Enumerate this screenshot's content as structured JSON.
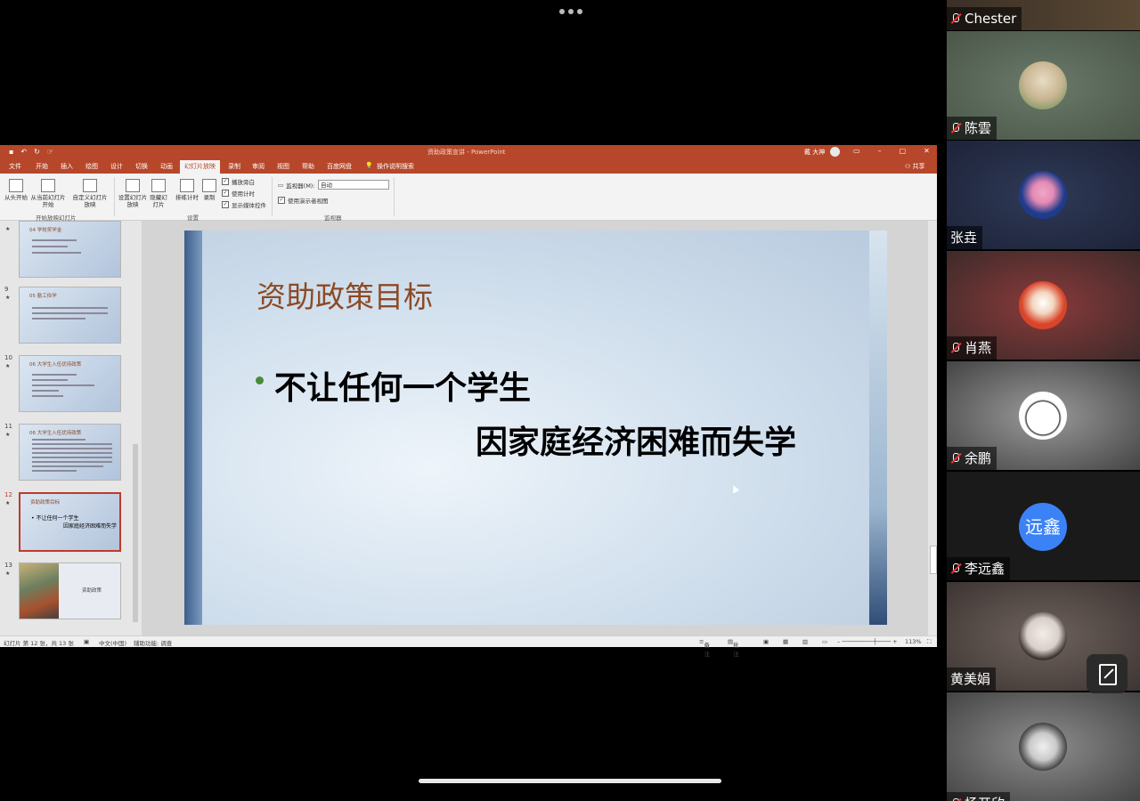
{
  "app": {
    "document_title": "资助政策宣讲 - PowerPoint",
    "user": "戴 大神",
    "share_label": "共享",
    "tabs": [
      "文件",
      "开始",
      "插入",
      "绘图",
      "设计",
      "切换",
      "动画",
      "幻灯片放映",
      "录制",
      "审阅",
      "视图",
      "帮助",
      "百度网盘",
      "操作说明搜索"
    ],
    "active_tab": "幻灯片放映"
  },
  "ribbon": {
    "from_start": "从头开始",
    "from_current": "从当前幻灯片开始",
    "custom": "自定义幻灯片放映",
    "group1": "开始放映幻灯片",
    "setup": "设置幻灯片放映",
    "hide": "隐藏幻灯片",
    "rehearse": "排练计时",
    "record": "录制",
    "chk_narration": "播放旁白",
    "chk_timing": "使用计时",
    "chk_media": "显示媒体控件",
    "group2": "设置",
    "monitor_label": "监视器(M):",
    "monitor_value": "自动",
    "chk_presenter": "使用演示者视图",
    "group3": "监视器"
  },
  "thumbs": [
    {
      "num": "",
      "title": "04 学校奖学金"
    },
    {
      "num": "9",
      "title": "05 勤工俭学"
    },
    {
      "num": "10",
      "title": "06 大学生入伍优待政策"
    },
    {
      "num": "11",
      "title": "06 大学生入伍优待政策"
    },
    {
      "num": "12",
      "title": "资助政策目标",
      "b1": "• 不让任何一个学生",
      "b2": "因家庭经济困难而失学"
    },
    {
      "num": "13",
      "title": "资助政策"
    }
  ],
  "slide": {
    "title": "资助政策目标",
    "line1": "不让任何一个学生",
    "line2": "因家庭经济困难而失学"
  },
  "status": {
    "slide_info": "幻灯片 第 12 张，共 13 张",
    "lang": "中文(中国)",
    "accessibility": "辅助功能: 调查",
    "notes": "备注",
    "comments": "批注",
    "zoom": "113%"
  },
  "participants": [
    {
      "name": "Chester",
      "muted": true
    },
    {
      "name": "陈雲",
      "muted": true
    },
    {
      "name": "张垚",
      "muted": false
    },
    {
      "name": "肖燕",
      "muted": true
    },
    {
      "name": "余鹏",
      "muted": true
    },
    {
      "name": "李远鑫",
      "muted": true,
      "initials": "远鑫"
    },
    {
      "name": "黄美娟",
      "muted": false
    },
    {
      "name": "杨开欣",
      "muted": true
    }
  ],
  "colors": {
    "ppt_accent": "#b7472a",
    "slide_title": "#8c4a25",
    "avatar_blue": "#3b82f6"
  }
}
